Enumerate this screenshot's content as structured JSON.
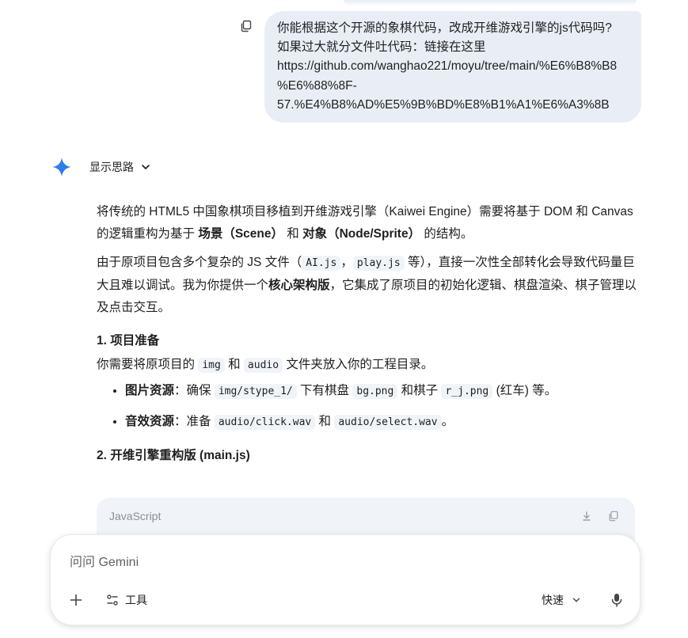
{
  "user_message": {
    "lines": [
      "你能根据这个开源的象棋代码，改成开维游戏引擎的js代码吗?",
      "如果过大就分文件吐代码：链接在这里",
      "https://github.com/wanghao221/moyu/tree/main/%E6%B8%B8",
      "%E6%88%8F-",
      "57.%E4%B8%AD%E5%9B%BD%E8%B1%A1%E6%A3%8B"
    ]
  },
  "model": {
    "show_thinking_label": "显示思路",
    "p1": {
      "a": "将传统的 HTML5 中国象棋项目移植到开维游戏引擎（Kaiwei Engine）需要将基于 DOM 和 Canvas 的逻辑重构为基于 ",
      "b": "场景（Scene）",
      "c": " 和 ",
      "d": "对象（Node/Sprite）",
      "e": " 的结构。"
    },
    "p2": {
      "a": "由于原项目包含多个复杂的 JS 文件（",
      "code1": "AI.js",
      "sep": "，",
      "code2": "play.js",
      "b": " 等），直接一次性全部转化会导致代码量巨大且难以调试。我为你提供一个",
      "bold": "核心架构版",
      "c": "，它集成了原项目的初始化逻辑、棋盘渲染、棋子管理以及点击交互。"
    },
    "section1": {
      "heading": "1. 项目准备",
      "text_a": "你需要将原项目的 ",
      "code_img": "img",
      "text_b": " 和 ",
      "code_audio": "audio",
      "text_c": " 文件夹放入你的工程目录。",
      "bullets": [
        {
          "label": "图片资源",
          "t1": "：确保 ",
          "c1": "img/stype_1/",
          "t2": " 下有棋盘 ",
          "c2": "bg.png",
          "t3": " 和棋子 ",
          "c3": "r_j.png",
          "t4": " (红车) 等。"
        },
        {
          "label": "音效资源",
          "t1": "：准备 ",
          "c1": "audio/click.wav",
          "t2": " 和 ",
          "c2": "audio/select.wav",
          "t3": "。"
        }
      ]
    },
    "section2": {
      "heading": "2. 开维引擎重构版 (main.js)"
    },
    "code_block": {
      "language": "JavaScript"
    }
  },
  "input": {
    "placeholder": "问问 Gemini",
    "tools_label": "工具",
    "mode_label": "快速"
  },
  "colors": {
    "bubble_bg": "#e9eef6",
    "code_bg": "#f0f4f9",
    "text": "#1f1f1f",
    "muted": "#5f6368",
    "gemini_blue": "#4285f4"
  },
  "icons": [
    "copy-icon",
    "gemini-sparkle-icon",
    "chevron-down-icon",
    "download-icon",
    "plus-icon",
    "tools-icon",
    "microphone-icon"
  ]
}
